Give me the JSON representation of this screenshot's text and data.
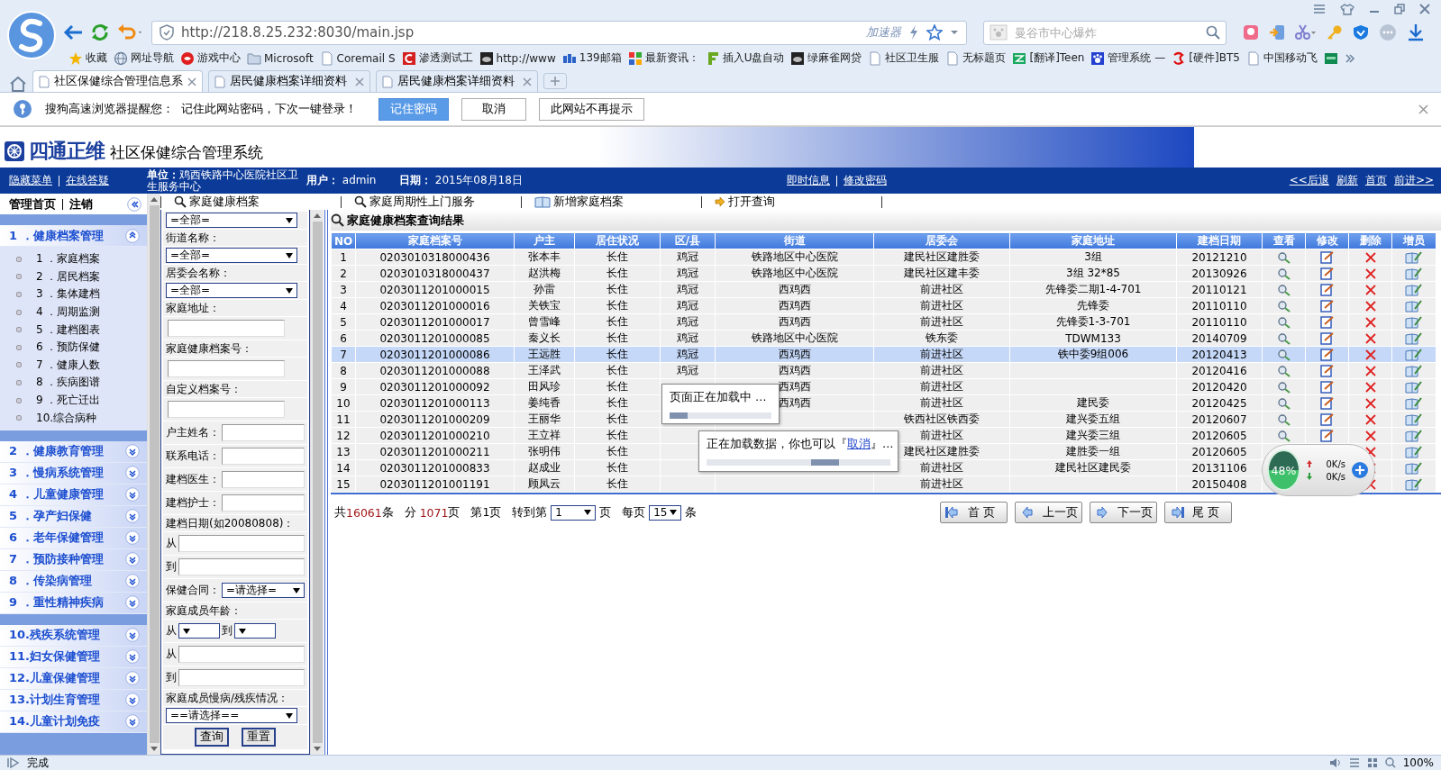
{
  "browser": {
    "url": "http://218.8.25.232:8030/main.jsp",
    "accelerator": "加速器",
    "search": {
      "placeholder": "曼谷市中心爆炸"
    },
    "bookmarks": [
      {
        "kind": "star",
        "label": "收藏"
      },
      {
        "kind": "globe",
        "label": "网址导航"
      },
      {
        "kind": "game",
        "label": "游戏中心"
      },
      {
        "kind": "folder",
        "label": "Microsoft"
      },
      {
        "kind": "page",
        "label": "Coremail S"
      },
      {
        "kind": "redc",
        "label": "渗透测试工"
      },
      {
        "kind": "dark",
        "label": "http://www"
      },
      {
        "kind": "bars",
        "label": "139邮箱"
      },
      {
        "kind": "mosaic",
        "label": "最新资讯："
      },
      {
        "kind": "greenf",
        "label": "插入U盘自动"
      },
      {
        "kind": "dark",
        "label": "绿麻雀网贷"
      },
      {
        "kind": "page",
        "label": "社区卫生服"
      },
      {
        "kind": "page",
        "label": "无标题页"
      },
      {
        "kind": "greensq",
        "label": "[翻译]Teen"
      },
      {
        "kind": "paw",
        "label": "管理系统 —"
      },
      {
        "kind": "redlogo",
        "label": "[硬件]BT5"
      },
      {
        "kind": "page",
        "label": "中国移动飞"
      },
      {
        "kind": "tealsq"
      }
    ],
    "tabs": [
      {
        "title": "社区保健综合管理信息系",
        "selected": true
      },
      {
        "title": "居民健康档案详细资料",
        "selected": false
      },
      {
        "title": "居民健康档案详细资料",
        "selected": false
      }
    ],
    "prompt": {
      "message": "搜狗高速浏览器提醒您：  记住此网站密码，下次一键登录！",
      "buttons": [
        {
          "label": "记住密码",
          "primary": true
        },
        {
          "label": "取消",
          "primary": false
        },
        {
          "label": "此网站不再提示",
          "primary": false
        }
      ]
    }
  },
  "header": {
    "brand": "四通正维",
    "title": "社区保健综合管理系统"
  },
  "nav": {
    "links": [
      "隐藏菜单",
      "在线答疑"
    ],
    "unit": "**单位：**鸡西铁路中心医院社区卫生服务中心",
    "user": "**用户：** admin",
    "date": "**日期：** 2015年08月18日",
    "center_links": [
      "即时信息",
      "修改密码"
    ],
    "right_links": [
      "<<后退",
      "刷新",
      "首页",
      "前进>>"
    ]
  },
  "sidebar": {
    "home": "管理首页",
    "logout": "注销",
    "groups": [
      [
        {
          "title": "1 ．健康档案管理",
          "expanded": true,
          "items": [
            "1 ．家庭档案",
            "2 ．居民档案",
            "3 ．集体建档",
            "4 ．周期监测",
            "5 ．建档图表",
            "6 ．预防保健",
            "7 ．健康人数",
            "8 ．疾病图谱",
            "9 ．死亡迁出",
            "10.综合病种"
          ]
        }
      ],
      [
        {
          "title": "2 ．健康教育管理",
          "expanded": false
        },
        {
          "title": "3 ．慢病系统管理",
          "expanded": false
        },
        {
          "title": "4 ．儿童健康管理",
          "expanded": false
        },
        {
          "title": "5 ．孕产妇保健",
          "expanded": false
        },
        {
          "title": "6 ．老年保健管理",
          "expanded": false
        },
        {
          "title": "7 ．预防接种管理",
          "expanded": false
        },
        {
          "title": "8 ．传染病管理",
          "expanded": false
        },
        {
          "title": "9 ．重性精神疾病",
          "expanded": false
        }
      ],
      [
        {
          "title": "10.残疾系统管理",
          "expanded": false
        },
        {
          "title": "11.妇女保健管理",
          "expanded": false
        },
        {
          "title": "12.儿童保健管理",
          "expanded": false
        },
        {
          "title": "13.计划生育管理",
          "expanded": false
        },
        {
          "title": "14.儿童计划免疫",
          "expanded": false
        }
      ]
    ]
  },
  "main_tabs": [
    {
      "label": "家庭健康档案",
      "kind": "search"
    },
    {
      "label": "家庭周期性上门服务",
      "kind": "search"
    },
    {
      "label": "新增家庭档案",
      "kind": "book"
    },
    {
      "label": "打开查询",
      "kind": "arrow"
    }
  ],
  "form": {
    "rows": [
      {
        "kind": "select",
        "value": "=全部="
      },
      {
        "kind": "label",
        "text": "街道名称："
      },
      {
        "kind": "select",
        "value": "=全部="
      },
      {
        "kind": "label",
        "text": "居委会名称："
      },
      {
        "kind": "select",
        "value": "=全部="
      },
      {
        "kind": "label",
        "text": "家庭地址："
      },
      {
        "kind": "input"
      },
      {
        "kind": "label",
        "text": "家庭健康档案号："
      },
      {
        "kind": "input"
      },
      {
        "kind": "label",
        "text": "自定义档案号："
      },
      {
        "kind": "input"
      },
      {
        "kind": "labeled_input",
        "label": "户主姓名："
      },
      {
        "kind": "labeled_input",
        "label": "联系电话："
      },
      {
        "kind": "labeled_input",
        "label": "建档医生："
      },
      {
        "kind": "labeled_input",
        "label": "建档护士："
      },
      {
        "kind": "label",
        "text": "建档日期(如20080808)："
      },
      {
        "kind": "labeled_input",
        "label": "从"
      },
      {
        "kind": "labeled_input",
        "label": "到"
      },
      {
        "kind": "labeled_select",
        "label": "保健合同：",
        "value": "=请选择="
      },
      {
        "kind": "label",
        "text": "家庭成员年龄："
      },
      {
        "kind": "range_select",
        "from": "从",
        "to": "到"
      },
      {
        "kind": "labeled_input",
        "label": "从"
      },
      {
        "kind": "labeled_input",
        "label": "到"
      },
      {
        "kind": "label",
        "text": "家庭成员慢病/残疾情况："
      },
      {
        "kind": "select",
        "value": "==请选择=="
      },
      {
        "kind": "buttons",
        "labels": [
          "查询",
          "重置"
        ]
      }
    ]
  },
  "results": {
    "title": "家庭健康档案查询结果",
    "columns": [
      {
        "label": "NO",
        "kind": "text"
      },
      {
        "label": "家庭档案号",
        "kind": "text"
      },
      {
        "label": "户主",
        "kind": "text"
      },
      {
        "label": "居住状况",
        "kind": "text"
      },
      {
        "label": "区/县",
        "kind": "text"
      },
      {
        "label": "街道",
        "kind": "text"
      },
      {
        "label": "居委会",
        "kind": "text"
      },
      {
        "label": "家庭地址",
        "kind": "text"
      },
      {
        "label": "建档日期",
        "kind": "text"
      },
      {
        "label": "查看",
        "kind": "view"
      },
      {
        "label": "修改",
        "kind": "edit"
      },
      {
        "label": "删除",
        "kind": "delete"
      },
      {
        "label": "增员",
        "kind": "add"
      }
    ],
    "rows": [
      {
        "no": "1",
        "file_no": "0203010318000436",
        "owner": "张本丰",
        "residence": "长住",
        "district": "鸡冠",
        "street": "铁路地区中心医院",
        "committee": "建民社区建胜委",
        "address": "3组",
        "date": "20121210",
        "selected": false
      },
      {
        "no": "2",
        "file_no": "0203010318000437",
        "owner": "赵洪梅",
        "residence": "长住",
        "district": "鸡冠",
        "street": "铁路地区中心医院",
        "committee": "建民社区建丰委",
        "address": "3组 32*85",
        "date": "20130926",
        "selected": false
      },
      {
        "no": "3",
        "file_no": "0203011201000015",
        "owner": "孙雷",
        "residence": "长住",
        "district": "鸡冠",
        "street": "西鸡西",
        "committee": "前进社区",
        "address": "先锋委二期1-4-701",
        "date": "20110121",
        "selected": false
      },
      {
        "no": "4",
        "file_no": "0203011201000016",
        "owner": "关铁宝",
        "residence": "长住",
        "district": "鸡冠",
        "street": "西鸡西",
        "committee": "前进社区",
        "address": "先锋委",
        "date": "20110110",
        "selected": false
      },
      {
        "no": "5",
        "file_no": "0203011201000017",
        "owner": "曾雪峰",
        "residence": "长住",
        "district": "鸡冠",
        "street": "西鸡西",
        "committee": "前进社区",
        "address": "先锋委1-3-701",
        "date": "20110110",
        "selected": false
      },
      {
        "no": "6",
        "file_no": "0203011201000085",
        "owner": "秦义长",
        "residence": "长住",
        "district": "鸡冠",
        "street": "铁路地区中心医院",
        "committee": "铁东委",
        "address": "TDWM133",
        "date": "20140709",
        "selected": false
      },
      {
        "no": "7",
        "file_no": "0203011201000086",
        "owner": "王远胜",
        "residence": "长住",
        "district": "鸡冠",
        "street": "西鸡西",
        "committee": "前进社区",
        "address": "铁中委9组006",
        "date": "20120413",
        "selected": true
      },
      {
        "no": "8",
        "file_no": "0203011201000088",
        "owner": "王泽武",
        "residence": "长住",
        "district": "鸡冠",
        "street": "西鸡西",
        "committee": "前进社区",
        "date": "20120416",
        "selected": false
      },
      {
        "no": "9",
        "file_no": "0203011201000092",
        "owner": "田风珍",
        "residence": "长住",
        "street": "西鸡西",
        "committee": "前进社区",
        "date": "20120420",
        "selected": false
      },
      {
        "no": "10",
        "file_no": "0203011201000113",
        "owner": "姜纯香",
        "residence": "长住",
        "street": "西鸡西",
        "committee": "前进社区",
        "address": "建民委",
        "date": "20120425",
        "selected": false
      },
      {
        "no": "11",
        "file_no": "0203011201000209",
        "owner": "王丽华",
        "residence": "长住",
        "committee": "铁西社区铁西委",
        "address": "建兴委五组",
        "date": "20120607",
        "selected": false
      },
      {
        "no": "12",
        "file_no": "0203011201000210",
        "owner": "王立祥",
        "residence": "长住",
        "committee": "前进社区",
        "address": "建兴委三组",
        "date": "20120605",
        "selected": false
      },
      {
        "no": "13",
        "file_no": "0203011201000211",
        "owner": "张明伟",
        "residence": "长住",
        "committee": "建民社区建胜委",
        "address": "建胜委一组",
        "date": "20120605",
        "selected": false
      },
      {
        "no": "14",
        "file_no": "0203011201000833",
        "owner": "赵成业",
        "residence": "长住",
        "committee": "前进社区",
        "address": "建民社区建民委",
        "date": "20131106",
        "selected": false
      },
      {
        "no": "15",
        "file_no": "0203011201001191",
        "owner": "顾凤云",
        "residence": "长住",
        "committee": "前进社区",
        "date": "20150408",
        "selected": false
      }
    ],
    "pager": [
      {
        "kind": "text",
        "text": "共"
      },
      {
        "kind": "count",
        "text": "16061"
      },
      {
        "kind": "text",
        "text": "条   分 "
      },
      {
        "kind": "count",
        "text": "1071"
      },
      {
        "kind": "text",
        "text": "页   第1页   转到第 "
      },
      {
        "kind": "select",
        "text": "1"
      },
      {
        "kind": "text",
        "text": " 页   每页 "
      },
      {
        "kind": "select",
        "text": "15"
      },
      {
        "kind": "text",
        "text": " 条"
      }
    ],
    "nav_buttons": [
      {
        "label": "首 页",
        "kind": "first"
      },
      {
        "label": "上一页",
        "kind": "prev"
      },
      {
        "label": "下一页",
        "kind": "next"
      },
      {
        "label": "尾 页",
        "kind": "last"
      }
    ]
  },
  "page_loading": {
    "message": "页面正在加载中 …",
    "level": 0.18
  },
  "data_loading": {
    "before": "正在加载数据，你也可以『",
    "link": "取消",
    "after": "』…",
    "level": 0.72
  },
  "network": {
    "percent": "48%",
    "up": "0K/s",
    "down": "0K/s"
  },
  "status_bar": {
    "text": "完成",
    "zoom": "100%"
  }
}
